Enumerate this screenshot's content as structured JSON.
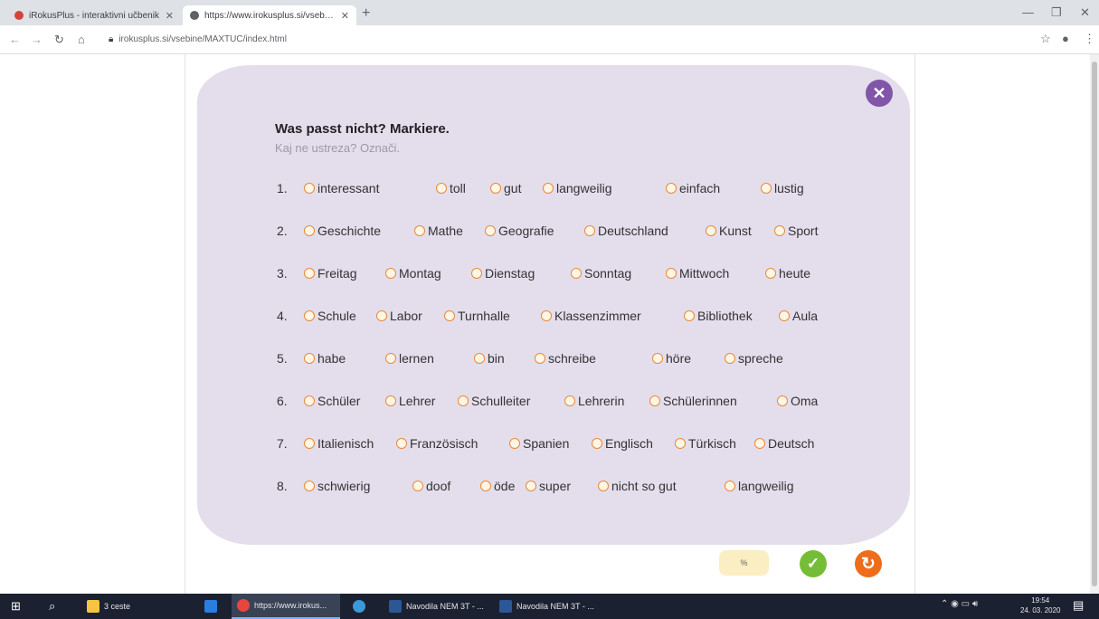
{
  "browser": {
    "tabs": [
      {
        "label": "iRokusPlus - interaktivni učbenik",
        "active": false,
        "icon": "rokus-favicon"
      },
      {
        "label": "https://www.irokusplus.si/vsebine/",
        "active": true,
        "icon": "globe-favicon"
      }
    ],
    "url": "irokusplus.si/vsebine/MAXTUC/index.html"
  },
  "exercise": {
    "title": "Was passt nicht? Markiere.",
    "subtitle": "Kaj ne ustreza? Označi.",
    "rows": [
      {
        "num": "1.",
        "options": [
          "interessant",
          "toll",
          "gut",
          "langweilig",
          "einfach",
          "lustig"
        ]
      },
      {
        "num": "2.",
        "options": [
          "Geschichte",
          "Mathe",
          "Geografie",
          "Deutschland",
          "Kunst",
          "Sport"
        ]
      },
      {
        "num": "3.",
        "options": [
          "Freitag",
          "Montag",
          "Dienstag",
          "Sonntag",
          "Mittwoch",
          "heute"
        ]
      },
      {
        "num": "4.",
        "options": [
          "Schule",
          "Labor",
          "Turnhalle",
          "Klassenzimmer",
          "Bibliothek",
          "Aula"
        ]
      },
      {
        "num": "5.",
        "options": [
          "habe",
          "lernen",
          "bin",
          "schreibe",
          "höre",
          "spreche"
        ]
      },
      {
        "num": "6.",
        "options": [
          "Schüler",
          "Lehrer",
          "Schulleiter",
          "Lehrerin",
          "Schülerinnen",
          "Oma"
        ]
      },
      {
        "num": "7.",
        "options": [
          "Italienisch",
          "Französisch",
          "Spanien",
          "Englisch",
          "Türkisch",
          "Deutsch"
        ]
      },
      {
        "num": "8.",
        "options": [
          "schwierig",
          "doof",
          "öde",
          "super",
          "nicht so gut",
          "langweilig"
        ]
      }
    ],
    "score_label": "%"
  },
  "taskbar": {
    "items": [
      {
        "label": "3 ceste",
        "icon": "folder-icon",
        "color": "#f5c542"
      },
      {
        "label": "",
        "icon": "edge-icon",
        "color": "#2a7de1"
      },
      {
        "label": "https://www.irokus...",
        "icon": "chrome-icon",
        "color": "#e8453c",
        "active": true
      },
      {
        "label": "",
        "icon": "cortana-icon",
        "color": "#3a9ad9"
      },
      {
        "label": "Navodila NEM 3T - ...",
        "icon": "word-icon",
        "color": "#2b5797"
      },
      {
        "label": "Navodila NEM 3T - ...",
        "icon": "word-icon",
        "color": "#2b5797"
      }
    ],
    "time": "19:54",
    "date": "24. 03. 2020"
  },
  "colors": {
    "card": "#e4ddec",
    "radio_border": "#e8893a",
    "close": "#8156a8",
    "check": "#76bd37",
    "reset": "#ef6c1a"
  }
}
